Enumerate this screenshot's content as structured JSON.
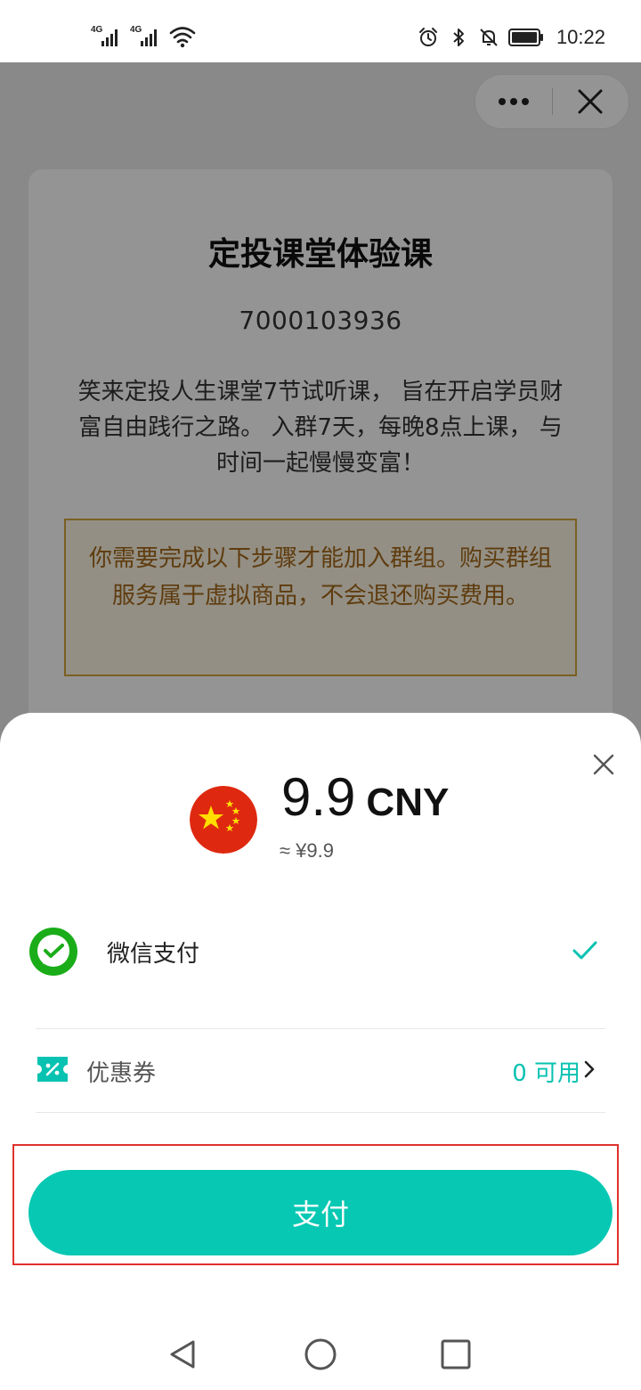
{
  "status_bar": {
    "network_1": "4G",
    "network_2": "4G",
    "time": "10:22"
  },
  "header": {
    "menu_icon": "more-dots-icon",
    "close_icon": "close-icon"
  },
  "card": {
    "title": "定投课堂体验课",
    "id": "7000103936",
    "description": "笑来定投人生课堂7节试听课，  旨在开启学员财富自由践行之路。  入群7天，每晚8点上课，  与时间一起慢慢变富！",
    "notice": "你需要完成以下步骤才能加入群组。购买群组服务属于虚拟商品，不会退还购买费用。"
  },
  "payment": {
    "currency_flag": "china-flag-icon",
    "amount": "9.9",
    "currency": "CNY",
    "approx": "≈ ¥9.9",
    "method_label": "微信支付",
    "method_selected": true,
    "coupon_label": "优惠券",
    "coupon_count": "0 可用",
    "pay_label": "支付"
  },
  "colors": {
    "accent": "#07c8b3",
    "notice_border": "#d4a53c",
    "notice_text": "#a4681a",
    "highlight": "#e0322d",
    "wechat_green": "#1aad19"
  }
}
